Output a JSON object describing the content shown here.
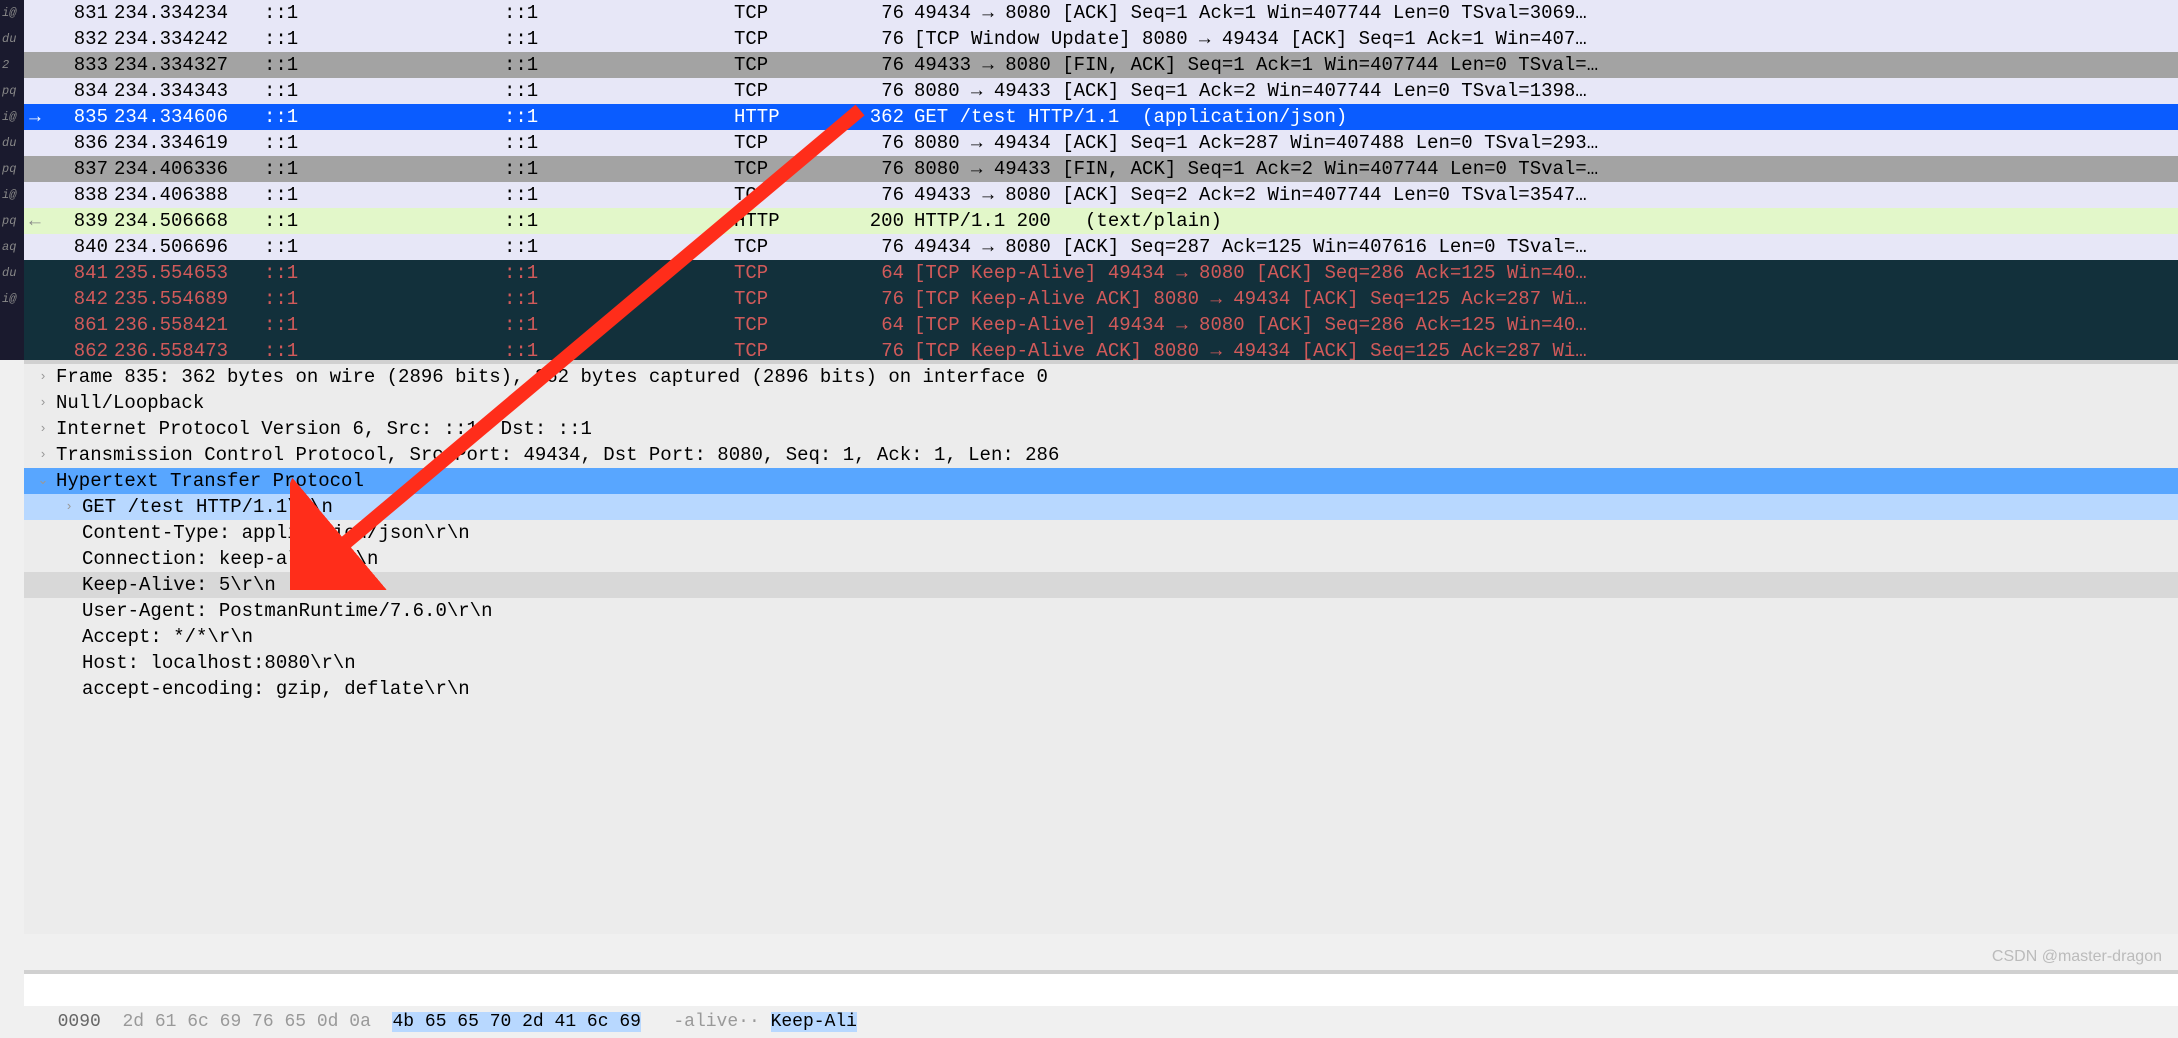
{
  "left_edge_labels": [
    "",
    "",
    "i@",
    "du",
    "",
    "2",
    "pq",
    "",
    "i@",
    "du",
    "pq",
    "i@",
    "pq",
    "aq",
    "du",
    "i@"
  ],
  "packets": [
    {
      "no": "831",
      "time": "234.334234",
      "src": "::1",
      "dst": "::1",
      "proto": "TCP",
      "len": "76",
      "info": "49434 → 8080 [ACK] Seq=1 Ack=1 Win=407744 Len=0 TSval=3069…",
      "cls": "row-lav"
    },
    {
      "no": "832",
      "time": "234.334242",
      "src": "::1",
      "dst": "::1",
      "proto": "TCP",
      "len": "76",
      "info": "[TCP Window Update] 8080 → 49434 [ACK] Seq=1 Ack=1 Win=407…",
      "cls": "row-lav"
    },
    {
      "no": "833",
      "time": "234.334327",
      "src": "::1",
      "dst": "::1",
      "proto": "TCP",
      "len": "76",
      "info": "49433 → 8080 [FIN, ACK] Seq=1 Ack=1 Win=407744 Len=0 TSval=…",
      "cls": "row-gray"
    },
    {
      "no": "834",
      "time": "234.334343",
      "src": "::1",
      "dst": "::1",
      "proto": "TCP",
      "len": "76",
      "info": "8080 → 49433 [ACK] Seq=1 Ack=2 Win=407744 Len=0 TSval=1398…",
      "cls": "row-lav"
    },
    {
      "no": "835",
      "time": "234.334606",
      "src": "::1",
      "dst": "::1",
      "proto": "HTTP",
      "len": "362",
      "info": "GET /test HTTP/1.1  (application/json)",
      "cls": "row-sel",
      "marker": "sel"
    },
    {
      "no": "836",
      "time": "234.334619",
      "src": "::1",
      "dst": "::1",
      "proto": "TCP",
      "len": "76",
      "info": "8080 → 49434 [ACK] Seq=1 Ack=287 Win=407488 Len=0 TSval=293…",
      "cls": "row-lav"
    },
    {
      "no": "837",
      "time": "234.406336",
      "src": "::1",
      "dst": "::1",
      "proto": "TCP",
      "len": "76",
      "info": "8080 → 49433 [FIN, ACK] Seq=1 Ack=2 Win=407744 Len=0 TSval=…",
      "cls": "row-gray"
    },
    {
      "no": "838",
      "time": "234.406388",
      "src": "::1",
      "dst": "::1",
      "proto": "TCP",
      "len": "76",
      "info": "49433 → 8080 [ACK] Seq=2 Ack=2 Win=407744 Len=0 TSval=3547…",
      "cls": "row-lav"
    },
    {
      "no": "839",
      "time": "234.506668",
      "src": "::1",
      "dst": "::1",
      "proto": "HTTP",
      "len": "200",
      "info": "HTTP/1.1 200   (text/plain)",
      "cls": "row-lime",
      "marker": "resp"
    },
    {
      "no": "840",
      "time": "234.506696",
      "src": "::1",
      "dst": "::1",
      "proto": "TCP",
      "len": "76",
      "info": "49434 → 8080 [ACK] Seq=287 Ack=125 Win=407616 Len=0 TSval=…",
      "cls": "row-lav"
    },
    {
      "no": "841",
      "time": "235.554653",
      "src": "::1",
      "dst": "::1",
      "proto": "TCP",
      "len": "64",
      "info": "[TCP Keep-Alive] 49434 → 8080 [ACK] Seq=286 Ack=125 Win=40…",
      "cls": "row-dark"
    },
    {
      "no": "842",
      "time": "235.554689",
      "src": "::1",
      "dst": "::1",
      "proto": "TCP",
      "len": "76",
      "info": "[TCP Keep-Alive ACK] 8080 → 49434 [ACK] Seq=125 Ack=287 Wi…",
      "cls": "row-dark"
    },
    {
      "no": "861",
      "time": "236.558421",
      "src": "::1",
      "dst": "::1",
      "proto": "TCP",
      "len": "64",
      "info": "[TCP Keep-Alive] 49434 → 8080 [ACK] Seq=286 Ack=125 Win=40…",
      "cls": "row-dark"
    },
    {
      "no": "862",
      "time": "236.558473",
      "src": "::1",
      "dst": "::1",
      "proto": "TCP",
      "len": "76",
      "info": "[TCP Keep-Alive ACK] 8080 → 49434 [ACK] Seq=125 Ack=287 Wi…",
      "cls": "row-dark"
    }
  ],
  "details": [
    {
      "indent": 0,
      "chev": "›",
      "text": "Frame 835: 362 bytes on wire (2896 bits), 362 bytes captured (2896 bits) on interface 0",
      "cls": ""
    },
    {
      "indent": 0,
      "chev": "›",
      "text": "Null/Loopback",
      "cls": ""
    },
    {
      "indent": 0,
      "chev": "›",
      "text": "Internet Protocol Version 6, Src: ::1, Dst: ::1",
      "cls": ""
    },
    {
      "indent": 0,
      "chev": "›",
      "text": "Transmission Control Protocol, Src Port: 49434, Dst Port: 8080, Seq: 1, Ack: 1, Len: 286",
      "cls": ""
    },
    {
      "indent": 0,
      "chev": "⌄",
      "text": "Hypertext Transfer Protocol",
      "cls": "sel-blue"
    },
    {
      "indent": 1,
      "chev": "›",
      "text": "GET /test HTTP/1.1\\r\\n",
      "cls": "sel-lightblue"
    },
    {
      "indent": 1,
      "chev": "",
      "text": "Content-Type: application/json\\r\\n",
      "cls": ""
    },
    {
      "indent": 1,
      "chev": "",
      "text": "Connection: keep-alive\\r\\n",
      "cls": ""
    },
    {
      "indent": 1,
      "chev": "",
      "text": "Keep-Alive: 5\\r\\n",
      "cls": "hl-gray"
    },
    {
      "indent": 1,
      "chev": "",
      "text": "User-Agent: PostmanRuntime/7.6.0\\r\\n",
      "cls": ""
    },
    {
      "indent": 1,
      "chev": "",
      "text": "Accept: */*\\r\\n",
      "cls": ""
    },
    {
      "indent": 1,
      "chev": "",
      "text": "Host: localhost:8080\\r\\n",
      "cls": ""
    },
    {
      "indent": 1,
      "chev": "",
      "text": "accept-encoding: gzip, deflate\\r\\n",
      "cls": ""
    }
  ],
  "bytes": {
    "offset": "0090",
    "hex_before": "2d 61 6c 69 76 65 0d 0a  ",
    "hex_sel": "4b 65 65 70 2d 41 6c 69",
    "ascii_before": "-alive·· ",
    "ascii_sel": "Keep-Ali"
  },
  "watermark": "CSDN @master-dragon"
}
